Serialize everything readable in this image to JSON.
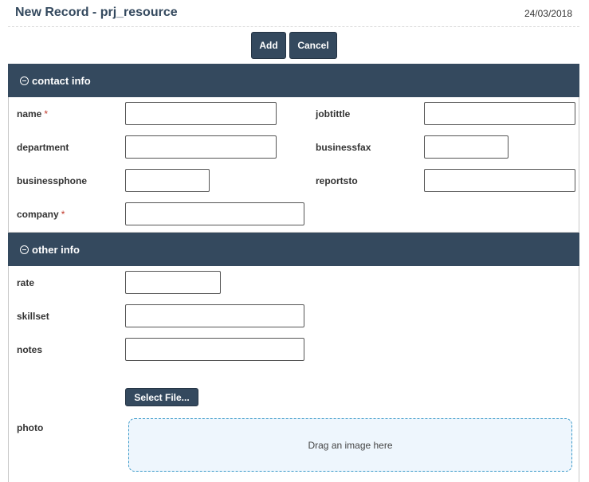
{
  "header": {
    "title": "New Record - prj_resource",
    "date": "24/03/2018"
  },
  "toolbar": {
    "add_label": "Add",
    "cancel_label": "Cancel"
  },
  "sections": {
    "contact": {
      "title": "contact info",
      "fields": {
        "name": {
          "label": "name",
          "required_mark": "*",
          "value": ""
        },
        "jobtittle": {
          "label": "jobtittle",
          "value": ""
        },
        "department": {
          "label": "department",
          "value": ""
        },
        "businessfax": {
          "label": "businessfax",
          "value": ""
        },
        "businessphone": {
          "label": "businessphone",
          "value": ""
        },
        "reportsto": {
          "label": "reportsto",
          "value": ""
        },
        "company": {
          "label": "company",
          "required_mark": "*",
          "value": ""
        }
      }
    },
    "other": {
      "title": "other info",
      "fields": {
        "rate": {
          "label": "rate",
          "value": ""
        },
        "skillset": {
          "label": "skillset",
          "value": ""
        },
        "notes": {
          "label": "notes",
          "value": ""
        },
        "photo": {
          "label": "photo",
          "select_button": "Select File...",
          "dropzone_text": "Drag an image here"
        }
      }
    }
  },
  "colors": {
    "header_bg": "#34495e",
    "required": "#c0392b",
    "dropzone_border": "#3a99c9",
    "dropzone_bg": "#eef6fd"
  },
  "icons": {
    "section_toggle": "minus-circle-icon"
  }
}
